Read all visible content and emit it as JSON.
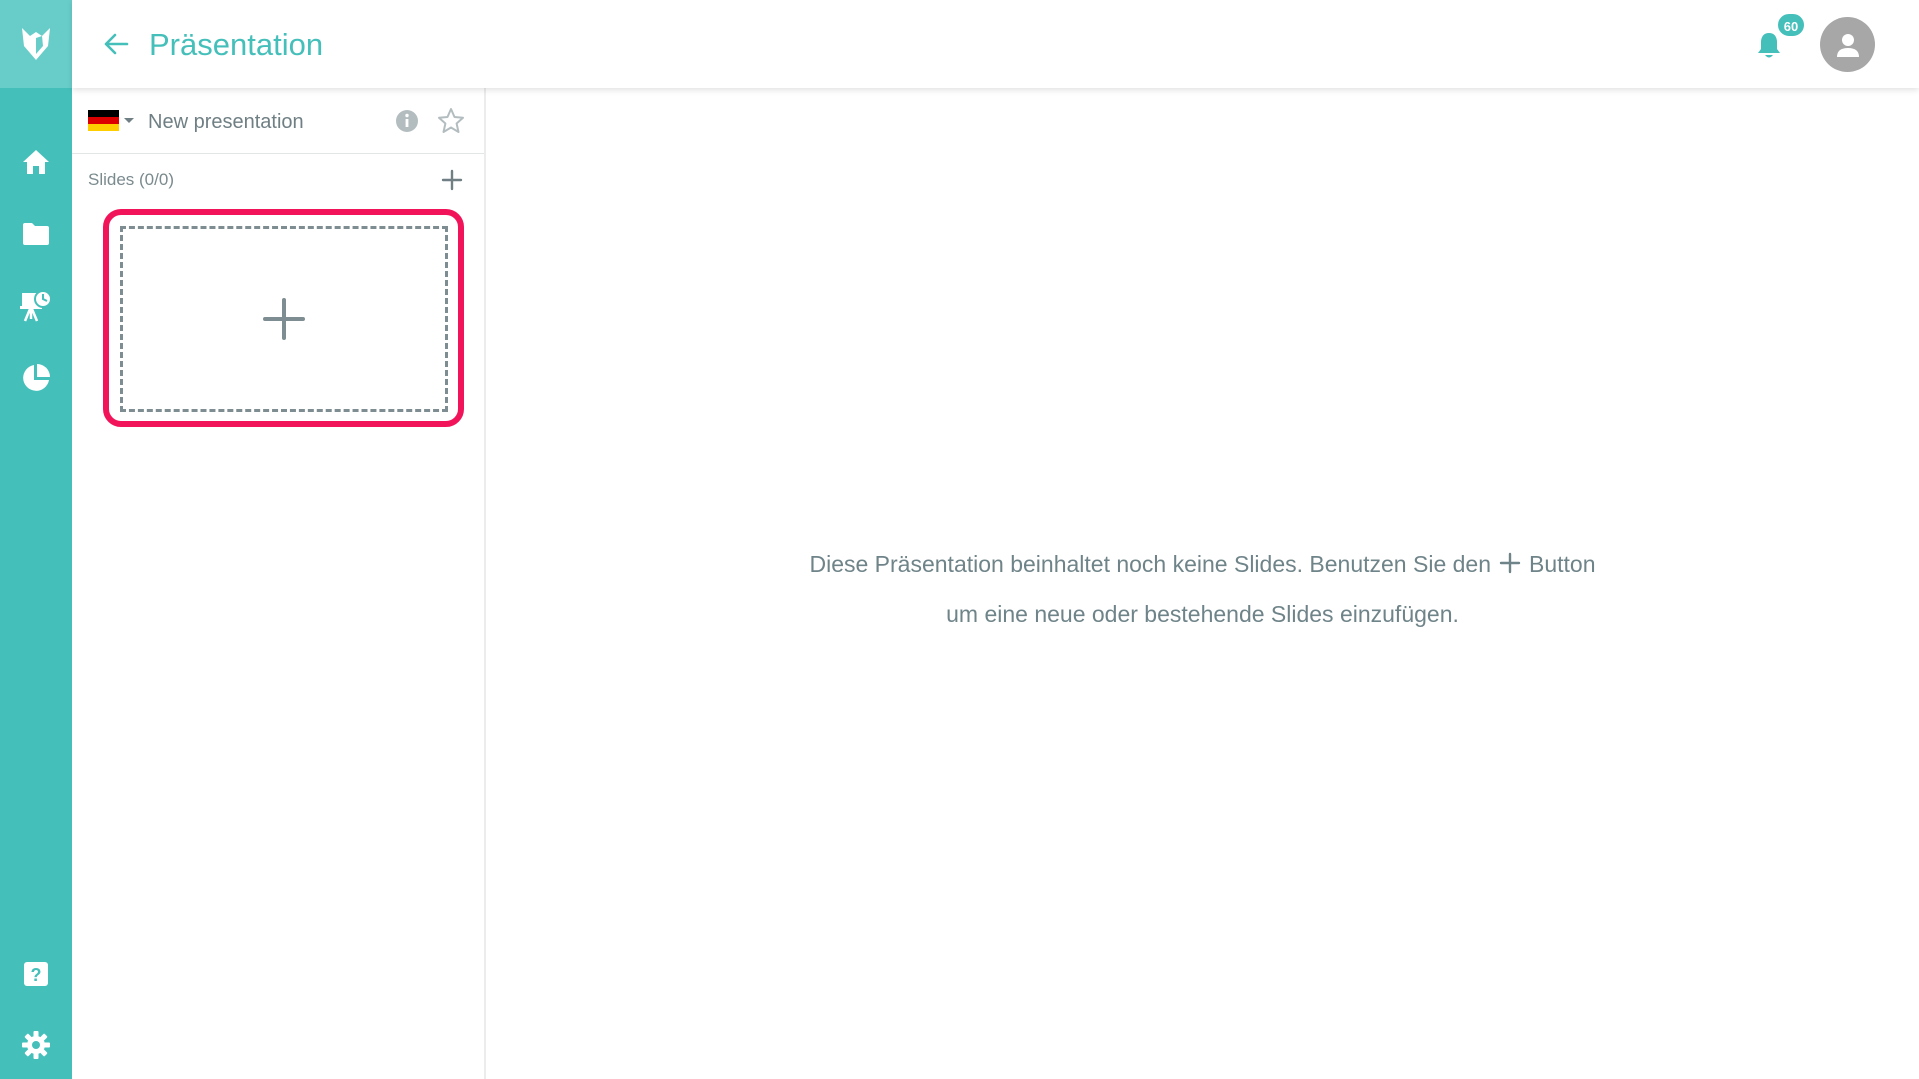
{
  "header": {
    "title": "Präsentation",
    "notification_count": "60"
  },
  "presentation": {
    "name": "New presentation",
    "language": "de"
  },
  "slides_panel": {
    "label": "Slides (0/0)"
  },
  "empty_state": {
    "line1_before": "Diese Präsentation beinhaltet noch keine Slides. Benutzen Sie den",
    "line1_after": "Button",
    "line2": "um eine neue oder bestehende Slides einzufügen."
  },
  "colors": {
    "accent": "#45bfba",
    "highlight": "#f2145a"
  },
  "icons": {
    "rail": [
      "home-icon",
      "folder-icon",
      "presentation-icon",
      "pie-chart-icon",
      "help-icon",
      "settings-icon"
    ]
  }
}
